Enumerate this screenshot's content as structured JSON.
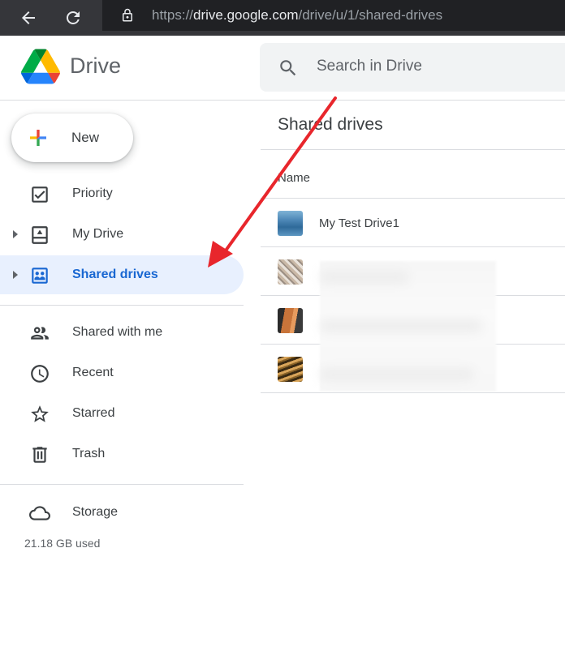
{
  "browser": {
    "url_host": "drive.google.com",
    "url_prefix": "https://",
    "url_path": "/drive/u/1/shared-drives"
  },
  "app": {
    "title": "Drive",
    "search_placeholder": "Search in Drive",
    "new_label": "New"
  },
  "sidebar": {
    "items": [
      {
        "label": "Priority",
        "icon": "priority-check-icon"
      },
      {
        "label": "My Drive",
        "icon": "my-drive-icon"
      },
      {
        "label": "Shared drives",
        "icon": "shared-drives-icon",
        "active": true
      },
      {
        "label": "Shared with me",
        "icon": "people-icon"
      },
      {
        "label": "Recent",
        "icon": "clock-icon"
      },
      {
        "label": "Starred",
        "icon": "star-icon"
      },
      {
        "label": "Trash",
        "icon": "trash-icon"
      },
      {
        "label": "Storage",
        "icon": "cloud-icon"
      }
    ],
    "storage_used": "21.18 GB used"
  },
  "main": {
    "title": "Shared drives",
    "column_name": "Name",
    "rows": [
      {
        "label": "My Test Drive1",
        "thumb": "water-thumbnail"
      },
      {
        "label": "",
        "thumb": "fabric-thumbnail"
      },
      {
        "label": "",
        "thumb": "wood-thumbnail"
      },
      {
        "label": "",
        "thumb": "stripes-thumbnail"
      }
    ]
  },
  "colors": {
    "accent": "#1967d2",
    "active_bg": "#e8f0fe",
    "annotation_red": "#e8262c"
  }
}
